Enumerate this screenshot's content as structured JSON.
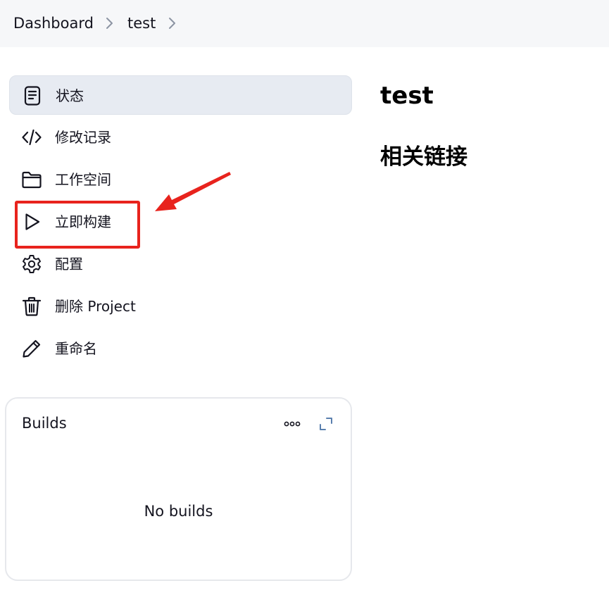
{
  "breadcrumb": {
    "items": [
      "Dashboard",
      "test"
    ]
  },
  "sidebar": {
    "items": [
      {
        "label": "状态",
        "icon": "document-icon",
        "active": true
      },
      {
        "label": "修改记录",
        "icon": "code-icon",
        "active": false
      },
      {
        "label": "工作空间",
        "icon": "folder-icon",
        "active": false
      },
      {
        "label": "立即构建",
        "icon": "play-icon",
        "active": false
      },
      {
        "label": "配置",
        "icon": "gear-icon",
        "active": false
      },
      {
        "label": "删除 Project",
        "icon": "trash-icon",
        "active": false
      },
      {
        "label": "重命名",
        "icon": "pencil-icon",
        "active": false
      }
    ]
  },
  "builds": {
    "title": "Builds",
    "empty_text": "No builds"
  },
  "main": {
    "title": "test",
    "related_heading": "相关链接"
  },
  "annotation": {
    "color": "#e8231d"
  }
}
